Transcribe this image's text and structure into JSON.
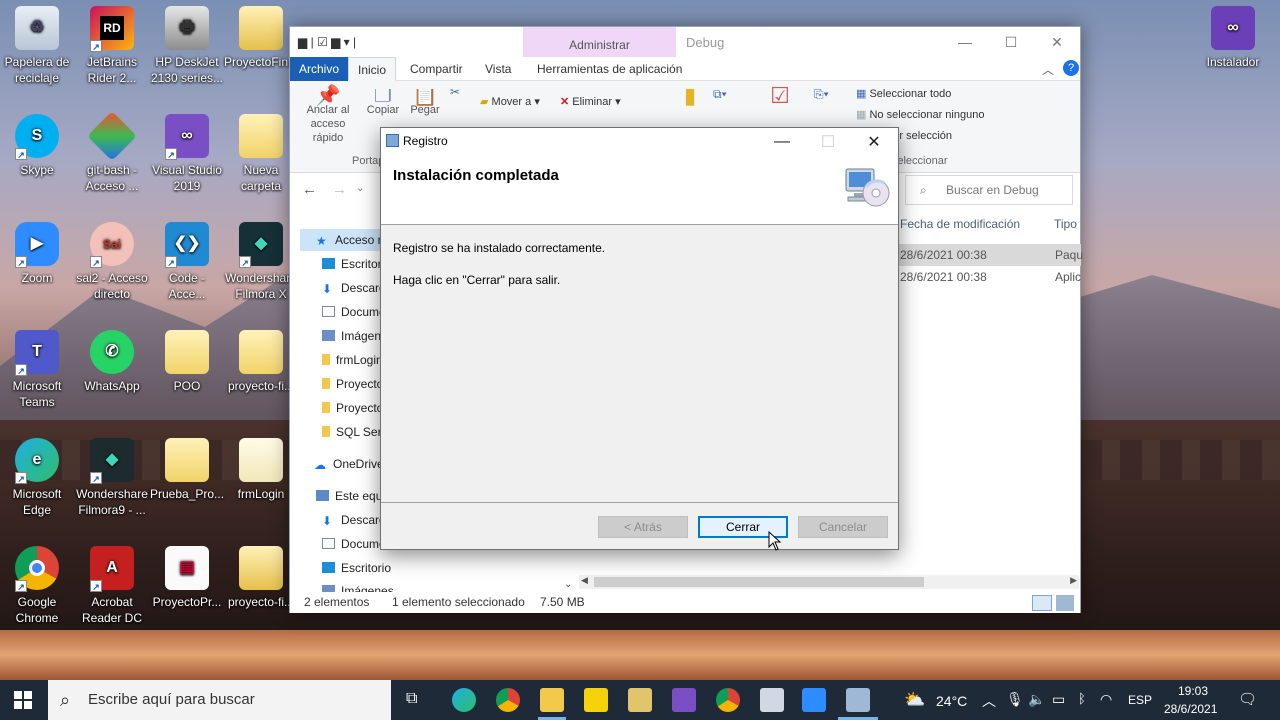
{
  "desktop": {
    "icons": [
      {
        "label": "Papelera de reciclaje"
      },
      {
        "label": "JetBrains Rider 2..."
      },
      {
        "label": "HP DeskJet 2130 series..."
      },
      {
        "label": "ProyectoFin..."
      },
      {
        "label": "Skype"
      },
      {
        "label": "git-bash - Acceso ..."
      },
      {
        "label": "Visual Studio 2019"
      },
      {
        "label": "Nueva carpeta"
      },
      {
        "label": "Zoom"
      },
      {
        "label": "sai2 - Acceso directo"
      },
      {
        "label": "Code - Acce..."
      },
      {
        "label": "Wondershare Filmora X"
      },
      {
        "label": "Microsoft Teams"
      },
      {
        "label": "WhatsApp"
      },
      {
        "label": "POO"
      },
      {
        "label": "proyecto-fi..."
      },
      {
        "label": "Microsoft Edge"
      },
      {
        "label": "Wondershare Filmora9 - ..."
      },
      {
        "label": "Prueba_Pro..."
      },
      {
        "label": "frmLogin"
      },
      {
        "label": "Google Chrome"
      },
      {
        "label": "Acrobat Reader DC"
      },
      {
        "label": "ProyectoPr..."
      },
      {
        "label": "proyecto-fi..."
      },
      {
        "label": "Instalador"
      }
    ]
  },
  "explorer": {
    "context_tab": "Administrar",
    "window_title": "Debug",
    "tabs": [
      "Archivo",
      "Inicio",
      "Compartir",
      "Vista",
      "Herramientas de aplicación"
    ],
    "ribbon": {
      "pin": "Anclar al acceso rápido",
      "copy": "Copiar",
      "paste": "Pegar",
      "group_portapapeles": "Portapapeles",
      "move_to": "Mover a",
      "delete": "Eliminar",
      "new": "Nueva",
      "properties": "Propiedades",
      "select_all": "Seleccionar todo",
      "select_none": "No seleccionar ninguno",
      "invert_selection": "Invertir selección",
      "group_select": "Seleccionar"
    },
    "search_placeholder": "Buscar en Debug",
    "columns": {
      "modified": "Fecha de modificación",
      "type": "Tipo"
    },
    "rows": [
      {
        "date": "28/6/2021 00:38",
        "type": "Paqu"
      },
      {
        "date": "28/6/2021 00:38",
        "type": "Aplic"
      }
    ],
    "tree": [
      {
        "label": "Acceso rápido"
      },
      {
        "label": "Escritorio"
      },
      {
        "label": "Descargas"
      },
      {
        "label": "Documentos"
      },
      {
        "label": "Imágenes"
      },
      {
        "label": "frmLogin"
      },
      {
        "label": "ProyectoFin"
      },
      {
        "label": "ProyectoFin"
      },
      {
        "label": "SQL Server"
      },
      {
        "label": "OneDrive"
      },
      {
        "label": "Este equipo"
      },
      {
        "label": "Descargas"
      },
      {
        "label": "Documentos"
      },
      {
        "label": "Escritorio"
      },
      {
        "label": "Imágenes"
      }
    ],
    "status": {
      "count": "2 elementos",
      "selection": "1 elemento seleccionado",
      "size": "7.50 MB"
    }
  },
  "dialog": {
    "title": "Registro",
    "heading": "Instalación completada",
    "message1": "Registro se ha instalado correctamente.",
    "message2": "Haga clic en \"Cerrar\" para salir.",
    "back_label": "< Atrás",
    "close_label": "Cerrar",
    "cancel_label": "Cancelar"
  },
  "taskbar": {
    "search_placeholder": "Escribe aquí para buscar",
    "temperature": "24°C",
    "language": "ESP",
    "time": "19:03",
    "date": "28/6/2021"
  }
}
